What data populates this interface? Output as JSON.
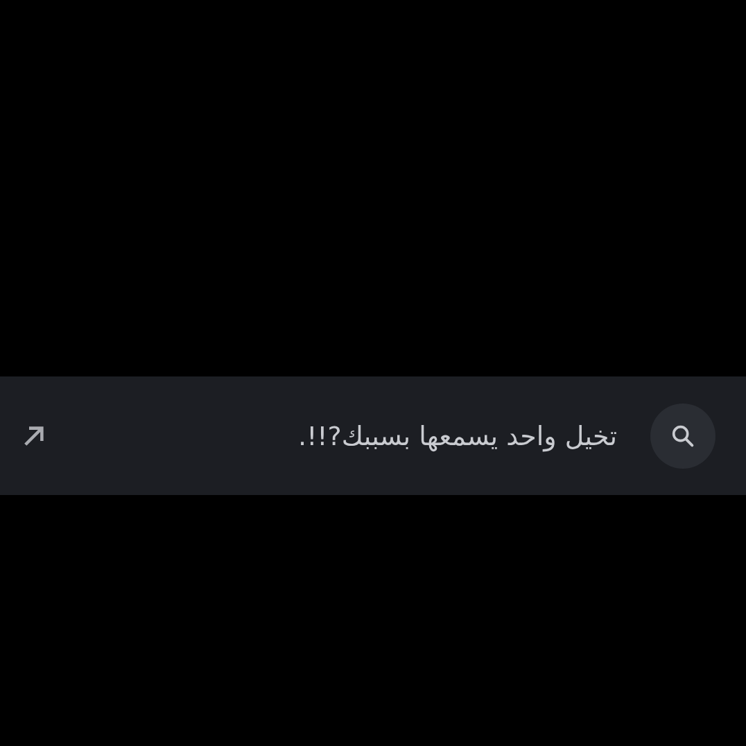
{
  "suggestion": {
    "text": "تخيل واحد يسمعها بسببك?!!."
  }
}
